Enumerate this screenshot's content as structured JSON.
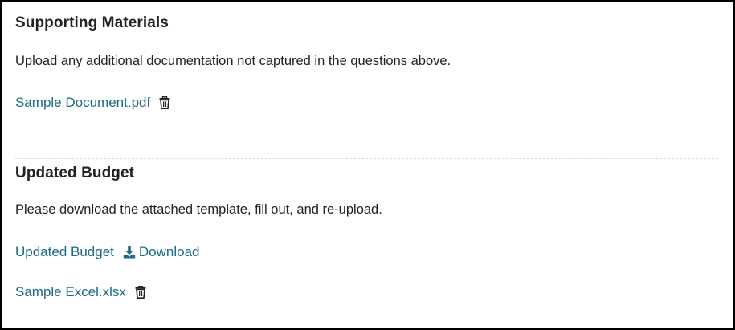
{
  "supporting": {
    "title": "Supporting Materials",
    "description": "Upload any additional documentation not captured in the questions above.",
    "file_name": "Sample Document.pdf",
    "delete_icon": "trash-icon"
  },
  "budget": {
    "title": "Updated Budget",
    "description": "Please download the attached template, fill out, and re-upload.",
    "template_link": "Updated Budget",
    "download_label": "Download",
    "download_icon": "download-icon",
    "file_name": "Sample Excel.xlsx",
    "delete_icon": "trash-icon"
  },
  "colors": {
    "link": "#1b6b84",
    "text": "#222222",
    "border": "#000000"
  }
}
